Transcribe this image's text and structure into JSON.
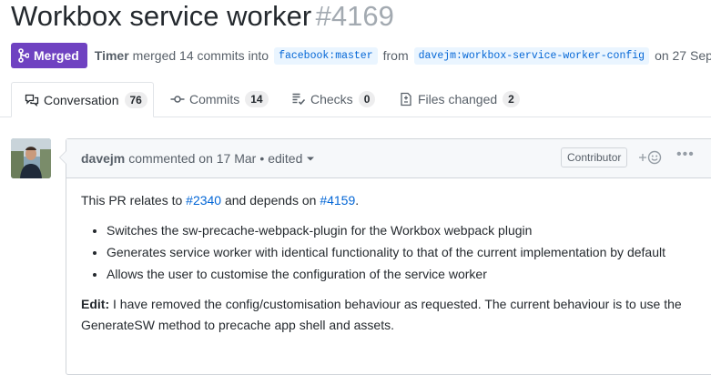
{
  "pr": {
    "title": "Workbox service worker",
    "number": "#4169",
    "state_label": "Merged",
    "author": "Timer",
    "merged_text": "merged 14 commits into",
    "base_ref": "facebook:master",
    "from_text": "from",
    "head_ref": "davejm:workbox-service-worker-config",
    "date_text": "on 27 Sep"
  },
  "tabs": [
    {
      "label": "Conversation",
      "count": "76",
      "icon": "comment-discussion-icon"
    },
    {
      "label": "Commits",
      "count": "14",
      "icon": "git-commit-icon"
    },
    {
      "label": "Checks",
      "count": "0",
      "icon": "checklist-icon"
    },
    {
      "label": "Files changed",
      "count": "2",
      "icon": "file-diff-icon"
    }
  ],
  "comment": {
    "author": "davejm",
    "commented_text": "commented on 17 Mar",
    "separator": "•",
    "edited_label": "edited",
    "role_badge": "Contributor",
    "intro_prefix": "This PR relates to ",
    "intro_link1": "#2340",
    "intro_middle": " and depends on ",
    "intro_link2": "#4159",
    "intro_suffix": ".",
    "bullets": [
      "Switches the sw-precache-webpack-plugin for the Workbox webpack plugin",
      "Generates service worker with identical functionality to that of the current implementation by default",
      "Allows the user to customise the configuration of the service worker"
    ],
    "edit_label": "Edit:",
    "edit_text": " I have removed the config/customisation behaviour as requested. The current behaviour is to use the GenerateSW method to precache app shell and assets."
  },
  "colors": {
    "merged": "#6f42c1",
    "link": "#0366d6",
    "muted": "#586069"
  }
}
